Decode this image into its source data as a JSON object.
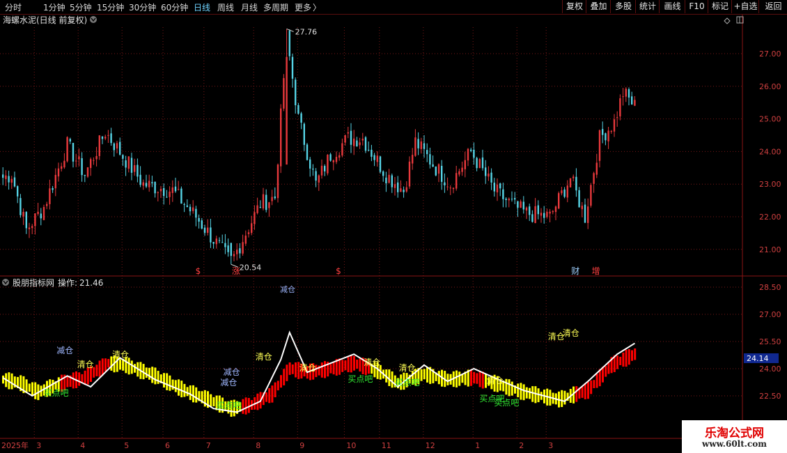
{
  "toolbar": {
    "periods": [
      "分时",
      "1分钟",
      "5分钟",
      "15分钟",
      "30分钟",
      "60分钟",
      "日线",
      "周线",
      "月线",
      "多周期",
      "更多"
    ],
    "active_period": "日线",
    "more_arrow": "〉",
    "buttons": [
      "复权",
      "叠加",
      "多股",
      "统计",
      "画线",
      "F10",
      "标记",
      "+自选",
      "返回"
    ]
  },
  "colors": {
    "up": "#e8393c",
    "down": "#56d4e6",
    "grid": "#7a1818",
    "axis_text": "#d04040",
    "white": "#ffffff",
    "yellow": "#ffff00",
    "red": "#ff0000",
    "label_blue": "#9fb7ff",
    "label_green": "#33ee33",
    "label_yellow": "#ffff55",
    "current_bg": "#102890"
  },
  "main_panel": {
    "title": "海螺水泥(日线 前复权)",
    "title_chevron_icon": "chevron-down-icon",
    "ticks": [
      "27.00",
      "26.00",
      "25.00",
      "24.00",
      "23.00",
      "22.00",
      "21.00"
    ],
    "high_label": "27.76",
    "low_label": "20.54",
    "markers": [
      {
        "text": "$",
        "index": 67
      },
      {
        "text": "涨",
        "index": 80
      },
      {
        "text": "$",
        "index": 115
      },
      {
        "text": "财",
        "index": 196
      },
      {
        "text": "增",
        "index": 203
      }
    ]
  },
  "sub_panel": {
    "title": "股朋指标网",
    "op_label": "操作:",
    "op_value": "21.46",
    "ticks": [
      "28.50",
      "27.00",
      "25.50",
      "24.00",
      "22.50"
    ],
    "bottom_tick": "21.00",
    "current_value": "24.14",
    "top_cut_label": "减仓",
    "labels": [
      {
        "text": "减仓",
        "index": 21,
        "color": "label_blue"
      },
      {
        "text": "清仓",
        "index": 28,
        "color": "label_yellow"
      },
      {
        "text": "清仓",
        "index": 40,
        "color": "label_yellow"
      },
      {
        "text": "买点吧",
        "index": 18,
        "color": "label_green"
      },
      {
        "text": "减仓",
        "index": 78,
        "color": "label_blue"
      },
      {
        "text": "减仓",
        "index": 77,
        "color": "label_blue"
      },
      {
        "text": "买点吧",
        "index": 77,
        "color": "label_green"
      },
      {
        "text": "清仓",
        "index": 89,
        "color": "label_yellow"
      },
      {
        "text": "清仓",
        "index": 104,
        "color": "label_yellow"
      },
      {
        "text": "买点吧",
        "index": 122,
        "color": "label_green"
      },
      {
        "text": "清仓",
        "index": 126,
        "color": "label_yellow"
      },
      {
        "text": "买点吧",
        "index": 138,
        "color": "label_green"
      },
      {
        "text": "清仓",
        "index": 138,
        "color": "label_yellow"
      },
      {
        "text": "买点吧",
        "index": 167,
        "color": "label_green"
      },
      {
        "text": "买点吧",
        "index": 172,
        "color": "label_green"
      },
      {
        "text": "清仓",
        "index": 168,
        "color": "label_yellow"
      },
      {
        "text": "清仓",
        "index": 189,
        "color": "label_yellow"
      },
      {
        "text": "清仓",
        "index": 194,
        "color": "label_yellow"
      }
    ]
  },
  "time_axis": {
    "labels": [
      {
        "text": "2025年",
        "index": 0
      },
      {
        "text": "3",
        "index": 11
      },
      {
        "text": "4",
        "index": 26
      },
      {
        "text": "5",
        "index": 41
      },
      {
        "text": "6",
        "index": 55
      },
      {
        "text": "7",
        "index": 69
      },
      {
        "text": "8",
        "index": 86
      },
      {
        "text": "9",
        "index": 101
      },
      {
        "text": "10",
        "index": 117
      },
      {
        "text": "11",
        "index": 129
      },
      {
        "text": "12",
        "index": 144
      },
      {
        "text": "1",
        "index": 161
      },
      {
        "text": "2",
        "index": 176
      },
      {
        "text": "3",
        "index": 186
      }
    ]
  },
  "watermark": {
    "name": "乐淘公式网",
    "url": "www.60lt.com"
  },
  "chart_data": {
    "type": "candlestick",
    "title": "海螺水泥(日线 前复权)",
    "y_range": [
      20.5,
      27.8
    ],
    "sub_y_range": [
      21.0,
      28.8
    ],
    "x": [
      "2025-02-05",
      "2025-02-06",
      "2025-02-07",
      "2025-02-10",
      "2025-02-11",
      "2025-02-12",
      "2025-02-13",
      "2025-02-14",
      "2025-02-17",
      "2025-02-18",
      "2025-02-19",
      "2025-02-20",
      "2025-02-21",
      "2025-02-24",
      "2025-02-25",
      "2025-02-26",
      "2025-02-27",
      "2025-02-28",
      "2025-03-03",
      "2025-03-04",
      "2025-03-05",
      "2025-03-06",
      "2025-03-07",
      "2025-03-10",
      "2025-03-11",
      "2025-03-12",
      "2025-03-13",
      "2025-03-14",
      "2025-03-17",
      "2025-03-18",
      "2025-03-19",
      "2025-03-20",
      "2025-03-21",
      "2025-03-24",
      "2025-03-25",
      "2025-03-26",
      "2025-03-27",
      "2025-03-28",
      "2025-03-31",
      "2025-04-01",
      "2025-04-02",
      "2025-04-03",
      "2025-04-07",
      "2025-04-08",
      "2025-04-09",
      "2025-04-10",
      "2025-04-11",
      "2025-04-14",
      "2025-04-15",
      "2025-04-16",
      "2025-04-17",
      "2025-04-18",
      "2025-04-21",
      "2025-04-22",
      "2025-04-23",
      "2025-04-24",
      "2025-04-25",
      "2025-04-28",
      "2025-04-29",
      "2025-04-30",
      "2025-05-06",
      "2025-05-07",
      "2025-05-08",
      "2025-05-09",
      "2025-05-12",
      "2025-05-13",
      "2025-05-14",
      "2025-05-15",
      "2025-05-16",
      "2025-05-19",
      "2025-05-20",
      "2025-05-21",
      "2025-05-22",
      "2025-05-23",
      "2025-05-26",
      "2025-05-27",
      "2025-05-28",
      "2025-05-29",
      "2025-05-30",
      "2025-06-03",
      "2025-06-04",
      "2025-06-05",
      "2025-06-06",
      "2025-06-09",
      "2025-06-10",
      "2025-06-11",
      "2025-06-12",
      "2025-06-13",
      "2025-06-16",
      "2025-06-17",
      "2025-06-18",
      "2025-06-19",
      "2025-06-20",
      "2025-06-23",
      "2025-06-24",
      "2025-06-25",
      "2025-06-26",
      "2025-06-27",
      "2025-06-30",
      "2025-07-01",
      "2025-07-02",
      "2025-07-03",
      "2025-07-04",
      "2025-07-07",
      "2025-07-08",
      "2025-07-09",
      "2025-07-10",
      "2025-07-11",
      "2025-07-14",
      "2025-07-15",
      "2025-07-16",
      "2025-07-17",
      "2025-07-18",
      "2025-07-21",
      "2025-07-22",
      "2025-07-23",
      "2025-07-24",
      "2025-07-25",
      "2025-07-28",
      "2025-07-29",
      "2025-07-30",
      "2025-07-31",
      "2025-08-01",
      "2025-08-04",
      "2025-08-05",
      "2025-08-06",
      "2025-08-07",
      "2025-08-08",
      "2025-08-11",
      "2025-08-12",
      "2025-08-13",
      "2025-08-14",
      "2025-08-15",
      "2025-08-18",
      "2025-08-19",
      "2025-08-20",
      "2025-08-21",
      "2025-08-22",
      "2025-08-25",
      "2025-08-26",
      "2025-08-27",
      "2025-08-28",
      "2025-08-29",
      "2025-09-01",
      "2025-09-02",
      "2025-09-03",
      "2025-09-04",
      "2025-09-05",
      "2025-09-08",
      "2025-09-09",
      "2025-09-10",
      "2025-09-11",
      "2025-09-12",
      "2025-09-15",
      "2025-09-16",
      "2025-09-17",
      "2025-09-18",
      "2025-09-19",
      "2025-09-22",
      "2025-09-23",
      "2025-09-24",
      "2025-09-25",
      "2025-09-26",
      "2025-09-29",
      "2025-09-30",
      "2025-10-09",
      "2025-10-10",
      "2025-10-13",
      "2025-10-14",
      "2025-10-15",
      "2025-10-16",
      "2025-10-17",
      "2025-10-20",
      "2025-10-21",
      "2025-10-22",
      "2025-10-23",
      "2025-10-24",
      "2025-10-27",
      "2025-10-28",
      "2025-10-29",
      "2025-10-30",
      "2025-10-31",
      "2025-11-03",
      "2025-11-04",
      "2025-11-05",
      "2025-11-06",
      "2025-11-07",
      "2025-11-10",
      "2025-11-11",
      "2025-11-12",
      "2025-11-13",
      "2025-11-14",
      "2025-11-17",
      "2025-11-18",
      "2025-11-19",
      "2025-11-20",
      "2025-11-21",
      "2025-11-24",
      "2025-11-25",
      "2025-11-26",
      "2025-11-27",
      "2025-11-28",
      "2025-12-01",
      "2025-12-02",
      "2025-12-03",
      "2025-12-04",
      "2025-12-05",
      "2025-12-08",
      "2025-12-09",
      "2025-12-10",
      "2025-12-11",
      "2025-12-12",
      "2025-12-15",
      "2025-12-16",
      "2025-12-17",
      "2025-12-18",
      "2025-12-19"
    ],
    "pivots": [
      [
        0,
        23.2
      ],
      [
        3,
        23.3
      ],
      [
        8,
        21.6
      ],
      [
        14,
        22.3
      ],
      [
        22,
        24.2
      ],
      [
        28,
        23.3
      ],
      [
        35,
        24.6
      ],
      [
        48,
        23.0
      ],
      [
        58,
        22.8
      ],
      [
        66,
        22.0
      ],
      [
        78,
        20.6
      ],
      [
        88,
        22.4
      ],
      [
        93,
        22.6
      ],
      [
        97,
        27.5
      ],
      [
        101,
        25.0
      ],
      [
        107,
        23.0
      ],
      [
        112,
        23.9
      ],
      [
        118,
        24.4
      ],
      [
        123,
        24.4
      ],
      [
        131,
        23.3
      ],
      [
        137,
        22.8
      ],
      [
        141,
        24.3
      ],
      [
        148,
        23.5
      ],
      [
        153,
        23.0
      ],
      [
        160,
        24.0
      ],
      [
        168,
        22.8
      ],
      [
        175,
        22.3
      ],
      [
        179,
        22.1
      ],
      [
        187,
        22.0
      ],
      [
        194,
        23.2
      ],
      [
        199,
        22.0
      ],
      [
        204,
        24.4
      ],
      [
        209,
        24.9
      ],
      [
        212,
        25.8
      ],
      [
        218,
        25.2
      ],
      [
        224,
        25.5
      ],
      [
        230,
        25.0
      ],
      [
        232,
        25.6
      ],
      [
        237,
        22.8
      ],
      [
        240,
        23.3
      ],
      [
        245,
        22.8
      ],
      [
        249,
        21.8
      ],
      [
        252,
        20.9
      ]
    ],
    "indicator_pivots": [
      [
        0,
        23.5
      ],
      [
        10,
        22.5
      ],
      [
        22,
        23.6
      ],
      [
        30,
        23.0
      ],
      [
        40,
        24.6
      ],
      [
        52,
        23.4
      ],
      [
        64,
        22.6
      ],
      [
        72,
        21.8
      ],
      [
        80,
        21.6
      ],
      [
        88,
        22.2
      ],
      [
        95,
        24.5
      ],
      [
        98,
        26.0
      ],
      [
        104,
        23.8
      ],
      [
        112,
        24.3
      ],
      [
        120,
        24.8
      ],
      [
        128,
        24.0
      ],
      [
        135,
        23.0
      ],
      [
        144,
        24.2
      ],
      [
        152,
        23.3
      ],
      [
        161,
        24.0
      ],
      [
        168,
        23.5
      ],
      [
        178,
        22.8
      ],
      [
        192,
        22.2
      ],
      [
        200,
        23.3
      ],
      [
        210,
        24.8
      ],
      [
        220,
        25.8
      ],
      [
        226,
        25.2
      ],
      [
        232,
        24.8
      ],
      [
        240,
        23.0
      ],
      [
        246,
        23.3
      ],
      [
        252,
        21.9
      ]
    ],
    "box_pivots": [
      [
        0,
        23.4
      ],
      [
        6,
        23.2
      ],
      [
        12,
        22.7
      ],
      [
        20,
        23.2
      ],
      [
        28,
        23.5
      ],
      [
        36,
        24.3
      ],
      [
        42,
        24.2
      ],
      [
        52,
        23.6
      ],
      [
        62,
        22.8
      ],
      [
        70,
        22.3
      ],
      [
        78,
        21.8
      ],
      [
        85,
        22.0
      ],
      [
        92,
        22.6
      ],
      [
        98,
        24.0
      ],
      [
        104,
        23.8
      ],
      [
        112,
        24.0
      ],
      [
        120,
        24.3
      ],
      [
        128,
        23.9
      ],
      [
        135,
        23.2
      ],
      [
        144,
        23.7
      ],
      [
        152,
        23.4
      ],
      [
        161,
        23.5
      ],
      [
        168,
        23.2
      ],
      [
        178,
        22.7
      ],
      [
        190,
        22.3
      ],
      [
        200,
        22.8
      ],
      [
        208,
        24.2
      ],
      [
        216,
        24.8
      ],
      [
        222,
        25.4
      ],
      [
        228,
        25.1
      ],
      [
        234,
        24.9
      ],
      [
        240,
        24.3
      ],
      [
        246,
        23.9
      ],
      [
        252,
        23.0
      ]
    ],
    "red_box_ranges": [
      [
        20,
        36
      ],
      [
        82,
        125
      ],
      [
        160,
        164
      ],
      [
        196,
        232
      ]
    ]
  }
}
